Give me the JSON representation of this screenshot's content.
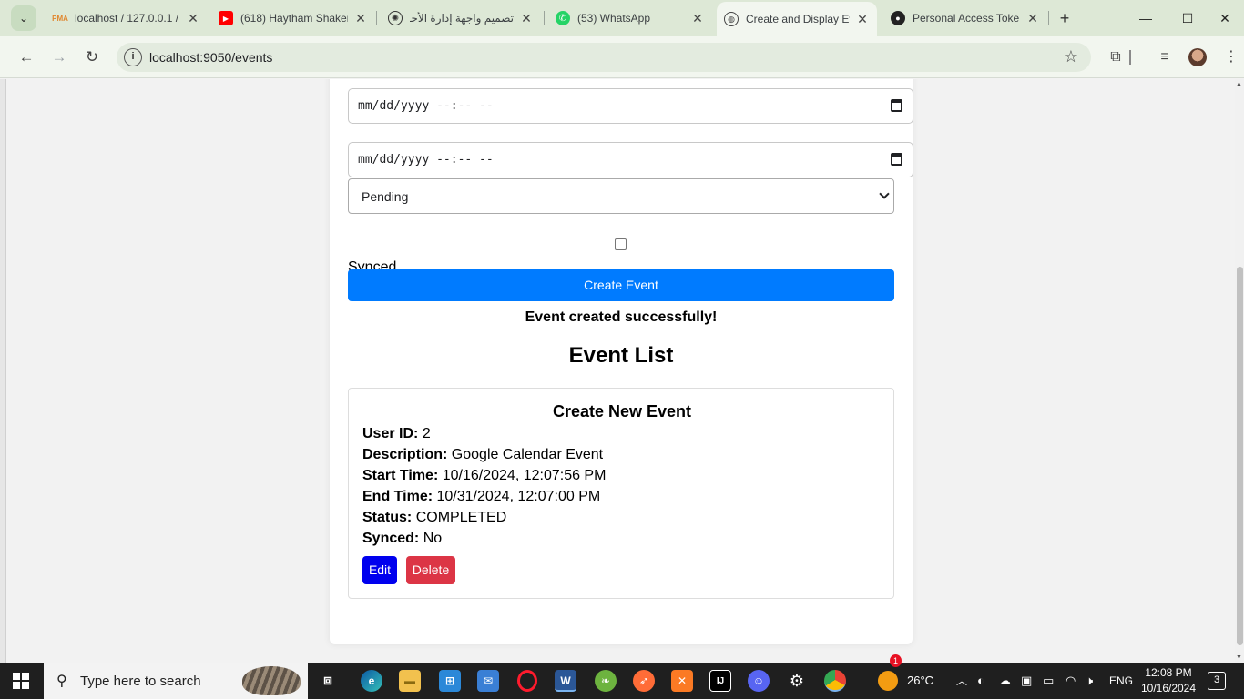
{
  "browser": {
    "tabs": [
      {
        "title": "localhost / 127.0.0.1 / ",
        "icon": "phpmyadmin-icon"
      },
      {
        "title": "(618) Haytham Shaker",
        "icon": "youtube-icon"
      },
      {
        "title": "تصميم واجهة إدارة الأحـ",
        "icon": "chatgpt-icon"
      },
      {
        "title": "(53) WhatsApp",
        "icon": "whatsapp-icon"
      },
      {
        "title": "Create and Display Ev",
        "icon": "globe-icon"
      },
      {
        "title": "Personal Access Toke",
        "icon": "github-icon"
      }
    ],
    "url": "localhost:9050/events"
  },
  "form": {
    "start_placeholder": "mm/dd/yyyy --:-- --",
    "end_placeholder": "mm/dd/yyyy --:-- --",
    "status_selected": "Pending",
    "synced_label": "Synced",
    "create_button": "Create Event",
    "success_message": "Event created successfully!"
  },
  "event_list": {
    "title": "Event List",
    "events": [
      {
        "title": "Create New Event",
        "user_id_label": "User ID:",
        "user_id": "2",
        "description_label": "Description:",
        "description": "Google Calendar Event",
        "start_label": "Start Time:",
        "start": "10/16/2024, 12:07:56 PM",
        "end_label": "End Time:",
        "end": "10/31/2024, 12:07:00 PM",
        "status_label": "Status:",
        "status": "COMPLETED",
        "synced_label": "Synced:",
        "synced": "No",
        "edit_button": "Edit",
        "delete_button": "Delete"
      }
    ]
  },
  "taskbar": {
    "search_placeholder": "Type here to search",
    "weather": "26°C",
    "language": "ENG",
    "time": "12:08 PM",
    "date": "10/16/2024",
    "notifications": "3",
    "weather_badge": "1"
  },
  "colors": {
    "primary": "#007bff",
    "edit": "#0000ee",
    "danger": "#dc3545"
  }
}
